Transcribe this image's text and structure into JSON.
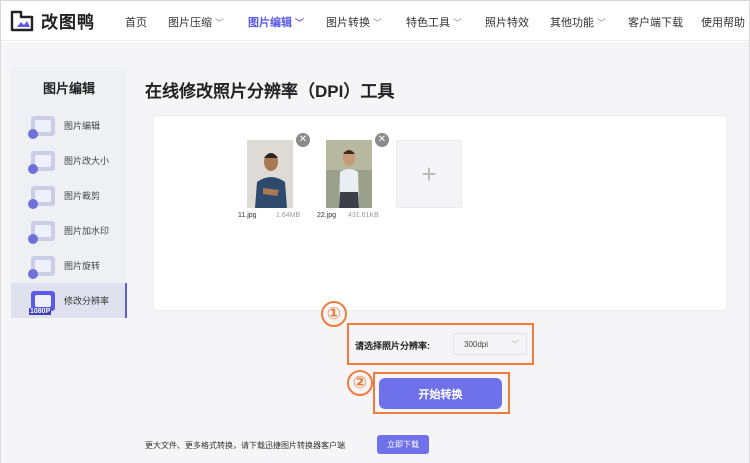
{
  "brand": {
    "name": "改图鸭",
    "accent": "#5b5ce6",
    "highlight": "#f07b3f"
  },
  "nav": {
    "items": [
      {
        "label": "首页",
        "has_dropdown": false,
        "active": false
      },
      {
        "label": "图片压缩",
        "has_dropdown": true,
        "active": false
      },
      {
        "label": "图片编辑",
        "has_dropdown": true,
        "active": true
      },
      {
        "label": "图片转换",
        "has_dropdown": true,
        "active": false
      },
      {
        "label": "特色工具",
        "has_dropdown": true,
        "active": false
      },
      {
        "label": "照片特效",
        "has_dropdown": false,
        "active": false
      },
      {
        "label": "其他功能",
        "has_dropdown": true,
        "active": false
      },
      {
        "label": "客户端下载",
        "has_dropdown": false,
        "active": false
      },
      {
        "label": "使用帮助",
        "has_dropdown": false,
        "active": false
      }
    ]
  },
  "sidebar": {
    "title": "图片编辑",
    "items": [
      {
        "label": "图片编辑",
        "icon": "edit-image-icon",
        "active": false
      },
      {
        "label": "图片改大小",
        "icon": "resize-image-icon",
        "active": false
      },
      {
        "label": "图片裁剪",
        "icon": "crop-image-icon",
        "active": false
      },
      {
        "label": "图片加水印",
        "icon": "watermark-image-icon",
        "active": false
      },
      {
        "label": "图片旋转",
        "icon": "rotate-image-icon",
        "active": false
      },
      {
        "label": "修改分辨率",
        "icon": "resolution-image-icon",
        "active": true,
        "badge": "1080P"
      }
    ]
  },
  "main": {
    "title": "在线修改照片分辨率（DPI）工具",
    "files": [
      {
        "name": "11.jpg",
        "size": "1.64MB"
      },
      {
        "name": "22.jpg",
        "size": "431.61KB"
      }
    ],
    "add_symbol": "+",
    "close_symbol": "✕",
    "step1": "①",
    "step2": "②",
    "dpi_label": "请选择照片分辨率:",
    "dpi_value": "300dpi",
    "convert_label": "开始转换"
  },
  "footer": {
    "text": "更大文件、更多格式转换，请下载迅捷图片转换器客户端",
    "download_label": "立即下载"
  }
}
